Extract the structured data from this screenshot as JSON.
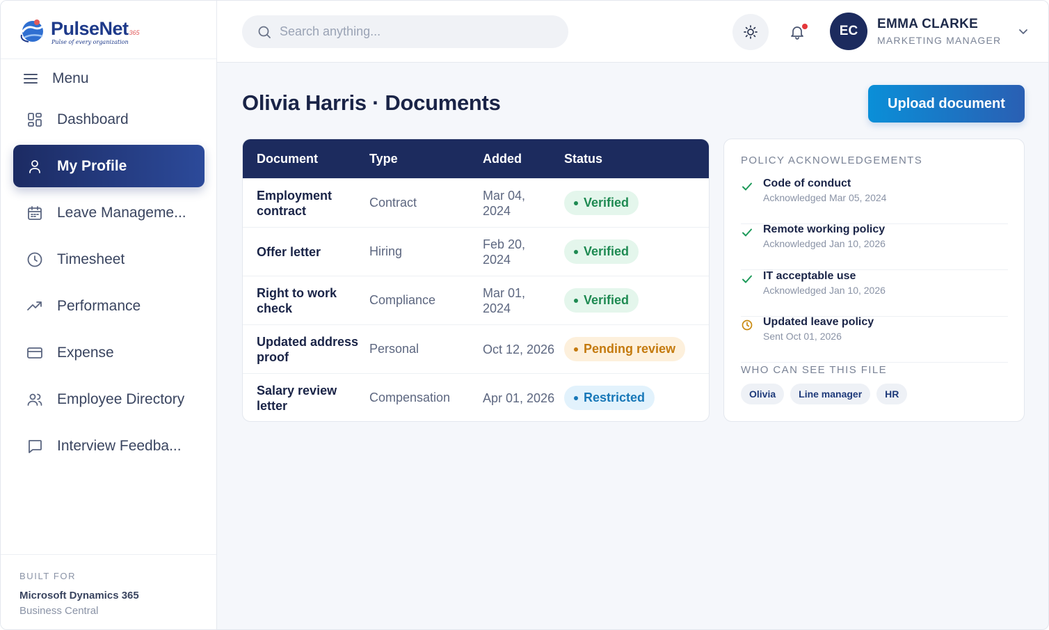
{
  "brand": {
    "name": "PulseNet",
    "superscript": "365",
    "tagline": "Pulse of every organization"
  },
  "sidebar": {
    "menu_label": "Menu",
    "items": [
      {
        "label": "Dashboard",
        "icon": "dashboard-icon"
      },
      {
        "label": "My Profile",
        "icon": "user-icon",
        "active": true
      },
      {
        "label": "Leave Manageme...",
        "icon": "calendar-icon"
      },
      {
        "label": "Timesheet",
        "icon": "clock-icon"
      },
      {
        "label": "Performance",
        "icon": "trending-up-icon"
      },
      {
        "label": "Expense",
        "icon": "credit-card-icon"
      },
      {
        "label": "Employee Directory",
        "icon": "users-icon"
      },
      {
        "label": "Interview Feedba...",
        "icon": "message-icon"
      }
    ],
    "built_for": {
      "label": "BUILT FOR",
      "product": "Microsoft Dynamics 365",
      "sub": "Business Central"
    }
  },
  "header": {
    "search_placeholder": "Search anything...",
    "user": {
      "initials": "EC",
      "name": "EMMA CLARKE",
      "role": "MARKETING MANAGER"
    }
  },
  "main": {
    "title": "Olivia Harris · Documents",
    "upload_label": "Upload document",
    "table": {
      "columns": [
        "Document",
        "Type",
        "Added",
        "Status"
      ],
      "rows": [
        {
          "document": "Employment contract",
          "type": "Contract",
          "added": "Mar 04, 2024",
          "status": "Verified",
          "status_kind": "verified"
        },
        {
          "document": "Offer letter",
          "type": "Hiring",
          "added": "Feb 20, 2024",
          "status": "Verified",
          "status_kind": "verified"
        },
        {
          "document": "Right to work check",
          "type": "Compliance",
          "added": "Mar 01, 2024",
          "status": "Verified",
          "status_kind": "verified"
        },
        {
          "document": "Updated address proof",
          "type": "Personal",
          "added": "Oct 12, 2026",
          "status": "Pending review",
          "status_kind": "pending"
        },
        {
          "document": "Salary review letter",
          "type": "Compensation",
          "added": "Apr 01, 2026",
          "status": "Restricted",
          "status_kind": "restricted"
        }
      ]
    }
  },
  "policies": {
    "title": "POLICY ACKNOWLEDGEMENTS",
    "items": [
      {
        "name": "Code of conduct",
        "sub": "Acknowledged Mar 05, 2024",
        "state": "done"
      },
      {
        "name": "Remote working policy",
        "sub": "Acknowledged Jan 10, 2026",
        "state": "done"
      },
      {
        "name": "IT acceptable use",
        "sub": "Acknowledged Jan 10, 2026",
        "state": "done"
      },
      {
        "name": "Updated leave policy",
        "sub": "Sent Oct 01, 2026",
        "state": "pending"
      }
    ],
    "access_title": "WHO CAN SEE THIS FILE",
    "access": [
      "Olivia",
      "Line manager",
      "HR"
    ]
  },
  "colors": {
    "navy": "#1c2b5e",
    "accent": "#0a8fd8",
    "verified": "#1e8a52",
    "pending": "#c47a0e",
    "restricted": "#1878b8"
  }
}
